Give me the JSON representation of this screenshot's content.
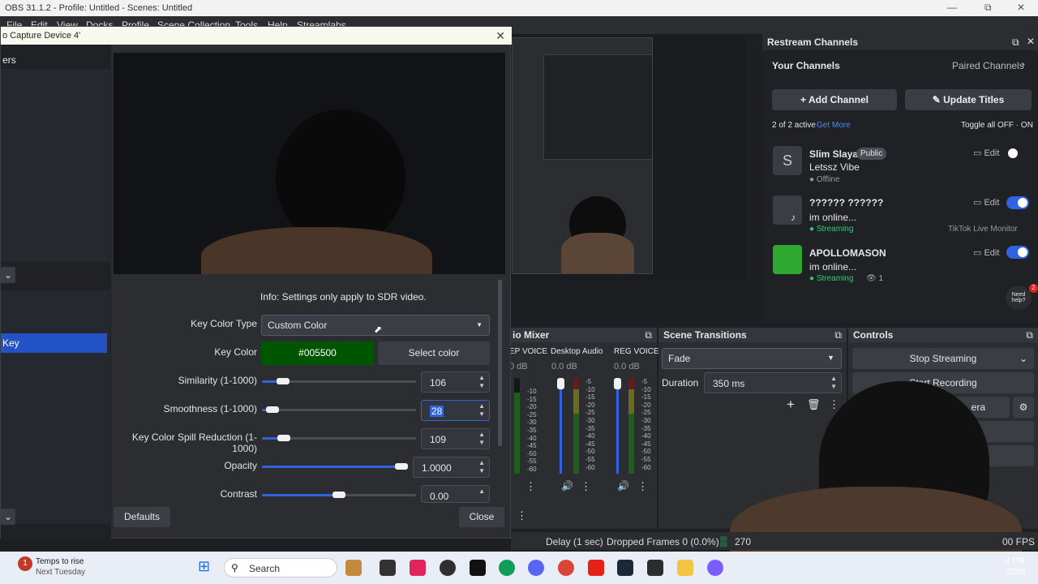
{
  "window": {
    "title": "OBS 31.1.2 - Profile: Untitled - Scenes: Untitled",
    "menu": [
      "File",
      "Edit",
      "View",
      "Docks",
      "Profile",
      "Scene Collection",
      "Tools",
      "Help",
      "Streamlabs"
    ]
  },
  "dialog": {
    "title": "o Capture Device 4'",
    "left_header": "ers",
    "selected_item": "Key",
    "info": "Info: Settings only apply to SDR video.",
    "key_color_type_label": "Key Color Type",
    "key_color_type_value": "Custom Color",
    "key_color_label": "Key Color",
    "key_color_value": "#005500",
    "select_color": "Select color",
    "similarity_label": "Similarity (1-1000)",
    "similarity_value": "106",
    "smoothness_label": "Smoothness (1-1000)",
    "smoothness_value": "28",
    "spill_label": "Key Color Spill Reduction (1-1000)",
    "spill_value": "109",
    "opacity_label": "Opacity",
    "opacity_value": "1.0000",
    "contrast_label": "Contrast",
    "contrast_value": "0.00",
    "defaults": "Defaults",
    "close": "Close",
    "key_color_hex": "#005500",
    "slider_levels": {
      "similarity": 0.106,
      "smoothness": 0.028,
      "spill": 0.109,
      "opacity": 1.0,
      "contrast": 0.5
    }
  },
  "restream": {
    "title": "Restream Channels",
    "your_channels": "Your Channels",
    "paired_channels": "Paired Channels",
    "add_channel": "Add Channel",
    "update_titles": "Update Titles",
    "active_count": "2 of 2 active",
    "get_more": "Get More",
    "toggle_all": "Toggle all OFF · ON",
    "edit": "Edit",
    "need_help": "Need help?",
    "help_badge": "2",
    "channels": [
      {
        "initial": "S",
        "name": "Slim Slaya",
        "badge": "Public",
        "title": "Letssz Vibe",
        "status": "Offline",
        "on": false
      },
      {
        "name": "?????? ??????",
        "title": "im online...",
        "status": "Streaming",
        "extra": "TikTok Live Monitor",
        "on": true
      },
      {
        "name": "APOLLOMASON",
        "title": "im online...",
        "status": "Streaming",
        "viewers": "1",
        "on": true
      }
    ]
  },
  "mixer": {
    "title": "io Mixer",
    "channels": [
      {
        "name": "EP VOICE",
        "db": "0 dB"
      },
      {
        "name": "Desktop Audio",
        "db": "0.0 dB"
      },
      {
        "name": "REG VOICE",
        "db": "0.0 dB"
      }
    ],
    "scale": [
      "-5",
      "-10",
      "-15",
      "-20",
      "-25",
      "-30",
      "-35",
      "-40",
      "-45",
      "-50",
      "-55",
      "-60"
    ]
  },
  "transitions": {
    "title": "Scene Transitions",
    "type": "Fade",
    "duration_label": "Duration",
    "duration_value": "350 ms"
  },
  "controls": {
    "title": "Controls",
    "stop_streaming": "Stop Streaming",
    "start_recording": "Start Recording",
    "virtual_camera": "era"
  },
  "status": {
    "delay": "Delay (1 sec)",
    "dropped": "Dropped Frames 0 (0.0%)",
    "bitrate": "270",
    "fps": "00 FPS"
  },
  "taskbar": {
    "weather_line1": "Temps to rise",
    "weather_line2": "Next Tuesday",
    "weather_badge": "1",
    "search": "Search",
    "time": "4 PM",
    "date": "/2026"
  }
}
